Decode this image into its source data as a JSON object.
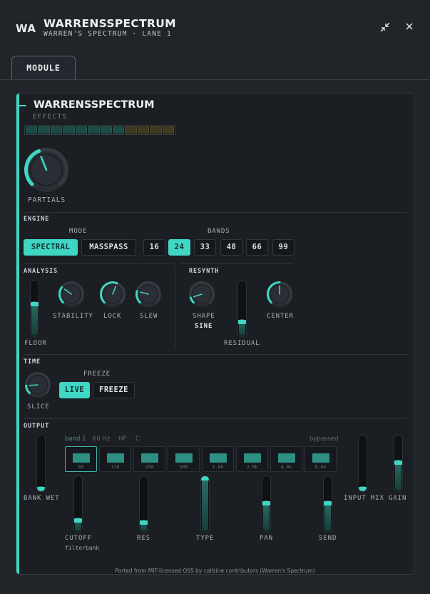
{
  "header": {
    "logo": "WA",
    "title": "WARRENSSPECTRUM",
    "subtitle": "WARREN'S SPECTRUM · LANE 1",
    "collapse_icon": "collapse-icon",
    "close_icon": "close-icon"
  },
  "tabs": [
    {
      "label": "MODULE",
      "active": true
    }
  ],
  "module": {
    "title": "WARRENSSPECTRUM",
    "category": "EFFECTS",
    "meter_segments_lit": 8,
    "meter_segments_total": 12
  },
  "partials": {
    "label": "PARTIALS",
    "value": 0.42
  },
  "engine": {
    "section": "ENGINE",
    "mode_label": "MODE",
    "modes": [
      "SPECTRAL",
      "MASSPASS"
    ],
    "mode_selected": "SPECTRAL",
    "bands_label": "BANDS",
    "bands": [
      "16",
      "24",
      "33",
      "48",
      "66",
      "99"
    ],
    "bands_selected": "24"
  },
  "analysis": {
    "section": "ANALYSIS",
    "floor": {
      "label": "FLOOR",
      "value": 0.62
    },
    "stability": {
      "label": "STABILITY",
      "value": 0.3
    },
    "lock": {
      "label": "LOCK",
      "value": 0.58
    },
    "slew": {
      "label": "SLEW",
      "value": 0.22
    }
  },
  "resynth": {
    "section": "RESYNTH",
    "shape": {
      "label": "SHAPE",
      "value_text": "SINE",
      "value": 0.1
    },
    "residual": {
      "label": "RESIDUAL",
      "value": 0.3
    },
    "center": {
      "label": "CENTER",
      "value": 0.5
    }
  },
  "time": {
    "section": "TIME",
    "slice": {
      "label": "SLICE",
      "value": 0.15
    },
    "freeze_label": "FREEZE",
    "freeze_options": [
      "LIVE",
      "FREEZE"
    ],
    "freeze_selected": "LIVE"
  },
  "output": {
    "section": "OUTPUT",
    "bank_wet": {
      "label": "BANK WET",
      "value": 0.05
    },
    "band_info": {
      "name": "band 1",
      "freq": "60 Hz",
      "type": "HP",
      "extra": "C",
      "status": "bypassed"
    },
    "bands": [
      "60",
      "120",
      "250",
      "500",
      "1.0k",
      "2.0k",
      "4.0k",
      "8.0k"
    ],
    "band_selected": 0,
    "cutoff": {
      "label": "CUTOFF",
      "sub": "filterbank",
      "value": 0.25
    },
    "res": {
      "label": "RES",
      "value": 0.2
    },
    "type": {
      "label": "TYPE",
      "value": 1.0
    },
    "pan": {
      "label": "PAN",
      "value": 0.55
    },
    "send": {
      "label": "SEND",
      "value": 0.55
    },
    "input_mix": {
      "label": "INPUT MIX",
      "value": 0.05
    },
    "gain": {
      "label": "GAIN",
      "value": 0.55
    }
  },
  "footer": "Ported from MIT-licensed OSS by callsine contributors (Warren's Spectrum)",
  "colors": {
    "accent": "#3fd6c4",
    "bg": "#212429",
    "panel": "#1b1e22"
  }
}
